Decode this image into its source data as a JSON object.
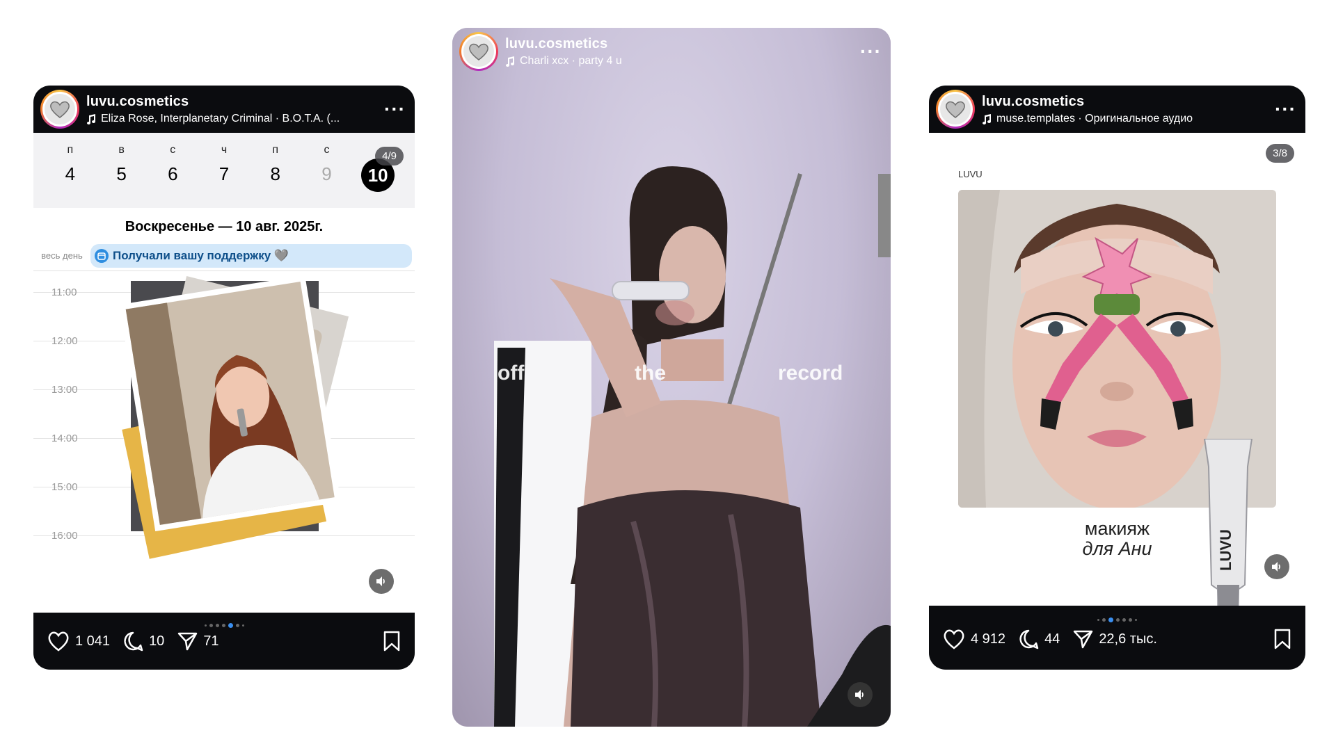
{
  "card1": {
    "username": "luvu.cosmetics",
    "audio": "Eliza Rose, Interplanetary Criminal · B.O.T.A. (...",
    "counter": "4/9",
    "week": [
      {
        "label": "п",
        "num": "4"
      },
      {
        "label": "в",
        "num": "5"
      },
      {
        "label": "с",
        "num": "6"
      },
      {
        "label": "ч",
        "num": "7"
      },
      {
        "label": "п",
        "num": "8"
      },
      {
        "label": "с",
        "num": "9"
      },
      {
        "label": "",
        "num": "10"
      }
    ],
    "date_header": "Воскресенье — 10 авг. 2025г.",
    "allday_label": "весь день",
    "event": "Получали вашу поддержку 🩶",
    "times": [
      "11:00",
      "12:00",
      "13:00",
      "14:00",
      "15:00",
      "16:00"
    ],
    "likes": "1 041",
    "comments": "10",
    "shares": "71",
    "slide": 4,
    "slides_total": 9
  },
  "card2": {
    "username": "luvu.cosmetics",
    "audio": "Charli xcx · party 4 u",
    "caption": [
      "off",
      "the",
      "record"
    ]
  },
  "card3": {
    "username": "luvu.cosmetics",
    "audio": "muse.templates · Оригинальное аудио",
    "counter": "3/8",
    "brand_small": "LUVU",
    "tagline1": "макияж",
    "tagline2": "для Ани",
    "likes": "4 912",
    "comments": "44",
    "shares": "22,6 тыс.",
    "slide": 3,
    "slides_total": 8
  },
  "icons": [
    "heart-icon",
    "comment-icon",
    "share-icon",
    "bookmark-icon",
    "music-note-icon",
    "more-icon",
    "speaker-icon"
  ]
}
